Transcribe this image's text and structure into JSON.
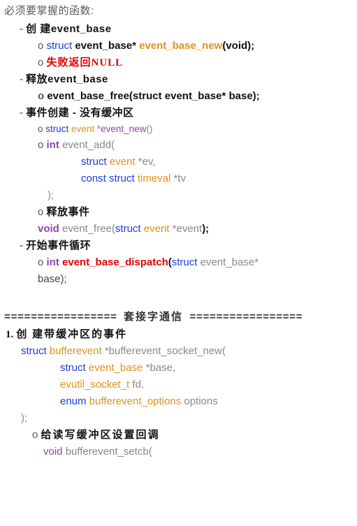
{
  "title": "必须要掌握的函数:",
  "sec1": {
    "h": "创 建event_base",
    "line1": {
      "struct": "struct",
      "type": "event_base*",
      "fn": "event_base_new",
      "args": "(void);"
    },
    "line2": "失败返回NULL"
  },
  "sec2": {
    "h": "释放event_base",
    "line1": {
      "fn": "event_base_free",
      "args": "(struct event_base* base);"
    }
  },
  "sec3": {
    "h": "事件创建 - 没有缓冲区",
    "line1": {
      "struct": "struct",
      "type": "event",
      "star": "*",
      "fn": "event_new",
      "paren": "()"
    },
    "line2": {
      "int": "int",
      "fn": "event_add",
      "open": "("
    },
    "line2a": {
      "struct": "struct",
      "type": "event",
      "rest": "*ev,"
    },
    "line2b": {
      "const": "const struct",
      "type": "timeval",
      "rest": "*tv"
    },
    "line2c": ");",
    "line3h": "释放事件",
    "line3": {
      "void": "void",
      "fn": "event_free",
      "open": "(",
      "struct": "struct",
      "type": "event",
      "rest": "*event",
      ")": ");"
    }
  },
  "sec4": {
    "h": "开始事件循环",
    "line1": {
      "int": "int",
      "fn": "event_base_dispatch",
      "open": "(",
      "struct": "struct",
      "rest": "event_base*"
    },
    "line1b": "base);"
  },
  "divider": {
    "eq": "================= ",
    "mid": "套接字通信",
    "eq2": " ================="
  },
  "sec5": {
    "num": "1.",
    "h": "创 建带缓冲区的事件",
    "l1": {
      "struct": "struct",
      "type": "bufferevent",
      "star": "*",
      "fn": "bufferevent_socket_new",
      "open": "("
    },
    "l2": {
      "struct": "struct",
      "type": "event_base",
      "rest": "*base,"
    },
    "l3": {
      "fn": "evutil_socket_t",
      "rest": "fd,"
    },
    "l4": {
      "enum": "enum",
      "type": "bufferevent_options",
      "rest": "options"
    },
    "l5": ");",
    "sub_h": "给读写缓冲区设置回调",
    "sub1": {
      "void": "void",
      "fn": "bufferevent_setcb",
      "open": "("
    }
  }
}
